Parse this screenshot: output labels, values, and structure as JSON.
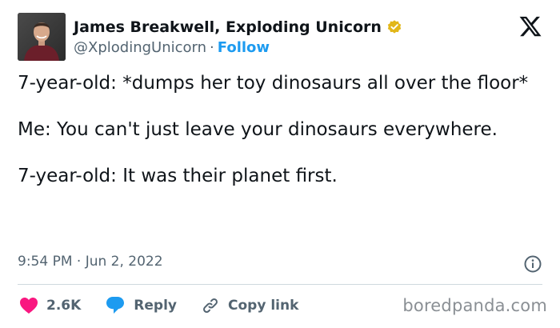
{
  "author": {
    "display_name": "James Breakwell, Exploding Unicorn",
    "handle": "@XplodingUnicorn",
    "separator": "·",
    "follow_label": "Follow",
    "verified_icon": "verified-badge-icon",
    "verified_color": "#e2b719"
  },
  "brand": {
    "logo_icon": "x-logo-icon"
  },
  "tweet": {
    "paragraphs": [
      "7-year-old: *dumps her toy dinosaurs all over the floor*",
      "Me: You can't just leave your dinosaurs everywhere.",
      "7-year-old: It was their planet first."
    ],
    "timestamp": "9:54 PM · Jun 2, 2022"
  },
  "actions": {
    "like_count": "2.6K",
    "like_color": "#f91880",
    "reply_label": "Reply",
    "reply_color": "#1d9bf0",
    "copy_link_label": "Copy link"
  },
  "watermark": "boredpanda.com",
  "colors": {
    "text": "#0f1419",
    "secondary": "#536471",
    "accent": "#1d9bf0",
    "divider": "#cfd9de"
  }
}
